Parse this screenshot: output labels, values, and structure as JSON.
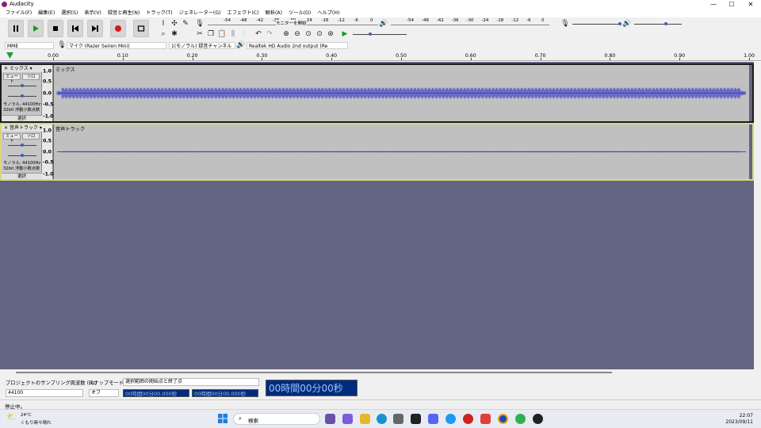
{
  "window": {
    "title": "Audacity",
    "min": "—",
    "max": "☐",
    "close": "✕"
  },
  "menu": [
    "ファイル(F)",
    "編集(E)",
    "選択(S)",
    "表示(V)",
    "録音と再生(N)",
    "トラック(T)",
    "ジェネレーター(G)",
    "エフェクト(C)",
    "解析(A)",
    "ツール(O)",
    "ヘルプ(H)"
  ],
  "meter": {
    "ticks": [
      "-54",
      "-48",
      "-42",
      "-36",
      "-30",
      "-24",
      "-18",
      "-12",
      "-6",
      "0"
    ],
    "monitor": "モニターを開始",
    "meter2_ticks": [
      "-54",
      "-48",
      "-42",
      "-36",
      "-30",
      "-24",
      "-18",
      "-12",
      "-6",
      "0"
    ]
  },
  "device": {
    "host": "MME",
    "input": "マイク (Razer Seiren Mini)",
    "channels": "1(モノラル) 録音チャンネル",
    "output": "Realtek HD Audio 2nd output (Re"
  },
  "ruler": [
    "0.00",
    "0.10",
    "0.20",
    "0.30",
    "0.40",
    "0.50",
    "0.60",
    "0.70",
    "0.80",
    "0.90",
    "1.00"
  ],
  "tracks": [
    {
      "name": "ミックス",
      "mute": "ミュート",
      "solo": "ソロ",
      "format1": "モノラル, 44100Hz",
      "format2": "32bit 浮動小数点数",
      "select": "選択",
      "scale": [
        "1.0",
        "0.5",
        "0.0",
        "-0.5",
        "-1.0"
      ]
    },
    {
      "name": "音声トラック",
      "mute": "ミュート",
      "solo": "ソロ",
      "format1": "モノラル, 44100Hz",
      "format2": "32bit 浮動小数点数",
      "select": "選択",
      "scale": [
        "1.0",
        "0.5",
        "0.0",
        "-0.5",
        "-1.0"
      ]
    }
  ],
  "selection": {
    "rate_label": "プロジェクトのサンプリング周波数 (Hz)",
    "rate": "44100",
    "snap_label": "スナップモード",
    "snap": "オフ",
    "range_label": "選択範囲の開始点と終了点",
    "start": "00時間00分00.000秒",
    "end": "00時間00分00.000秒",
    "big": "00時間00分00秒"
  },
  "status": "停止中。",
  "taskbar": {
    "temp": "24°C",
    "weather": "くもり時々晴れ",
    "search": "検索",
    "time": "22:07",
    "date": "2023/09/11"
  }
}
